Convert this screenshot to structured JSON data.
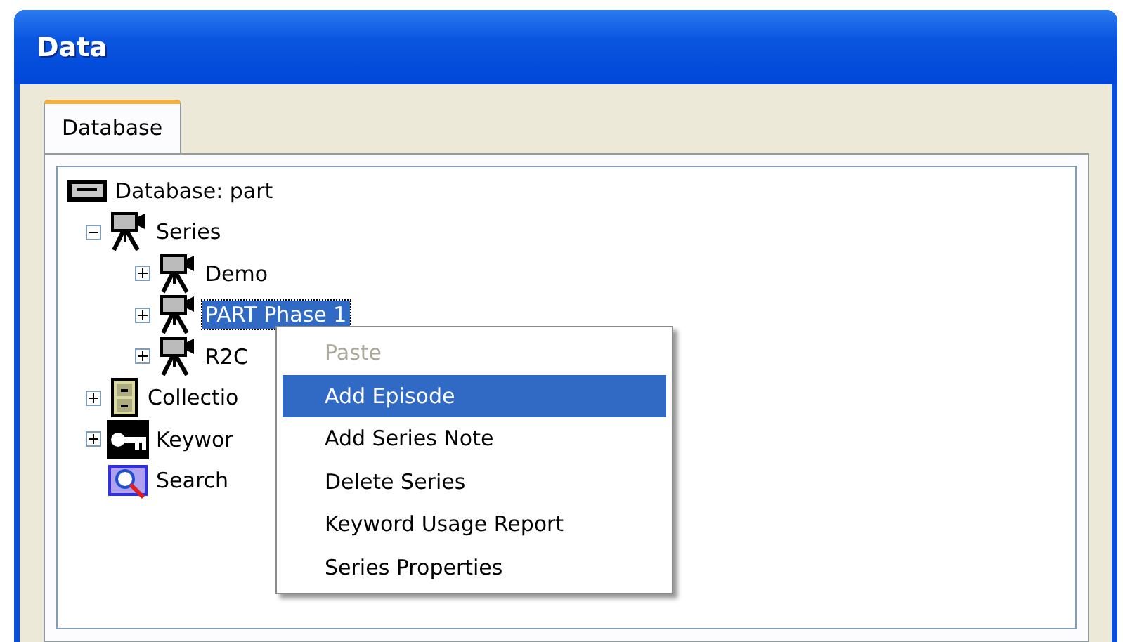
{
  "window": {
    "title": "Data"
  },
  "tabs": [
    {
      "label": "Database",
      "selected": true
    }
  ],
  "tree": [
    {
      "label": "Database: part",
      "kind": "database",
      "selected": false,
      "children": [
        {
          "label": "Series",
          "kind": "camera",
          "expanded": true,
          "selected": false,
          "children": [
            {
              "label": "Demo",
              "kind": "camera",
              "expanded": false,
              "selected": false
            },
            {
              "label": "PART Phase 1",
              "kind": "camera",
              "expanded": false,
              "selected": true
            },
            {
              "label": "R2C",
              "kind": "camera",
              "expanded": false,
              "selected": false
            }
          ]
        },
        {
          "label": "Collectio",
          "kind": "cabinet",
          "expanded": false,
          "selected": false
        },
        {
          "label": "Keywor",
          "kind": "key",
          "expanded": false,
          "selected": false
        },
        {
          "label": "Search",
          "kind": "search",
          "selected": false
        }
      ]
    }
  ],
  "context_menu": [
    {
      "label": "Paste",
      "disabled": true,
      "selected": false
    },
    {
      "label": "Add Episode",
      "disabled": false,
      "selected": true
    },
    {
      "label": "Add Series Note",
      "disabled": false,
      "selected": false
    },
    {
      "label": "Delete Series",
      "disabled": false,
      "selected": false
    },
    {
      "label": "Keyword Usage Report",
      "disabled": false,
      "selected": false
    },
    {
      "label": "Series Properties",
      "disabled": false,
      "selected": false
    }
  ]
}
